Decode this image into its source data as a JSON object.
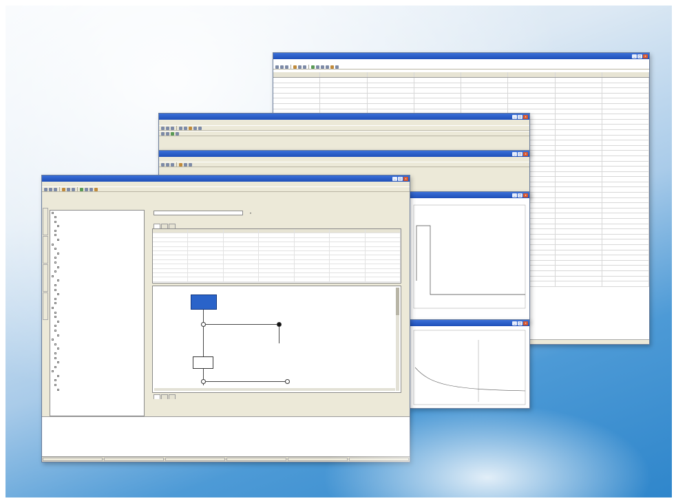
{
  "window_controls": {
    "minimize": "_",
    "maximize": "□",
    "close": "x"
  },
  "back_window": {
    "columns": [
      "",
      "",
      "",
      "",
      "",
      "",
      "",
      ""
    ],
    "rows": [
      [
        "",
        "",
        "",
        "",
        "",
        "",
        "",
        ""
      ],
      [
        "",
        "",
        "",
        "",
        "",
        "",
        "",
        ""
      ],
      [
        "",
        "",
        "",
        "",
        "",
        "",
        "",
        ""
      ],
      [
        "",
        "",
        "",
        "",
        "",
        "",
        "",
        ""
      ],
      [
        "",
        "",
        "",
        "",
        "",
        "",
        "",
        ""
      ],
      [
        "",
        "",
        "",
        "",
        "",
        "",
        "",
        ""
      ],
      [
        "",
        "",
        "",
        "",
        "",
        "",
        "",
        ""
      ],
      [
        "",
        "",
        "",
        "",
        "",
        "",
        "",
        ""
      ]
    ]
  },
  "front_window": {
    "tree_items": 40,
    "tabs": [
      "",
      "",
      ""
    ],
    "bottom_tabs": [
      "",
      "",
      ""
    ]
  },
  "colors": {
    "titlebar": "#2559c4",
    "background_blue": "#2f86cb",
    "flow_node": "#2a63c9",
    "red_text": "#c00000"
  }
}
